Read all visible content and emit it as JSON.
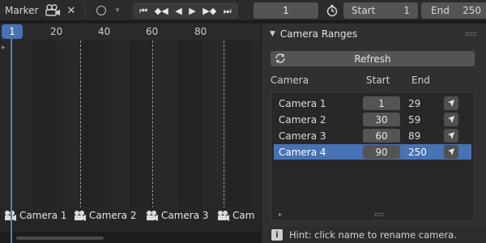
{
  "toolbar": {
    "marker_label": "Marker",
    "current_frame": "1",
    "start_label": "Start",
    "start_value": "1",
    "end_label": "End",
    "end_value": "250",
    "icons": [
      "camera-icon",
      "close-icon",
      "keyframe-circle-icon",
      "jump-start-icon",
      "prev-keyframe-icon",
      "play-reverse-icon",
      "play-icon",
      "next-keyframe-icon",
      "jump-end-icon",
      "stopwatch-icon"
    ]
  },
  "timeline": {
    "current_frame_badge": "1",
    "ticks": [
      "20",
      "40",
      "60",
      "80"
    ],
    "markers": [
      {
        "label": "Camera 1"
      },
      {
        "label": "Camera 2"
      },
      {
        "label": "Camera 3"
      },
      {
        "label": "Cam"
      }
    ]
  },
  "panel": {
    "title": "Camera Ranges",
    "refresh_label": "Refresh",
    "columns": {
      "camera": "Camera",
      "start": "Start",
      "end": "End"
    },
    "cameras": [
      {
        "name": "Camera 1",
        "start": "1",
        "end": "29",
        "active": false
      },
      {
        "name": "Camera 2",
        "start": "30",
        "end": "59",
        "active": false
      },
      {
        "name": "Camera 3",
        "start": "60",
        "end": "89",
        "active": false
      },
      {
        "name": "Camera 4",
        "start": "90",
        "end": "250",
        "active": true
      }
    ],
    "hint": "Hint: click name to rename camera."
  },
  "colors": {
    "accent": "#4772b3",
    "background": "#1d1d1d",
    "panel": "#303030",
    "field": "#545454"
  }
}
